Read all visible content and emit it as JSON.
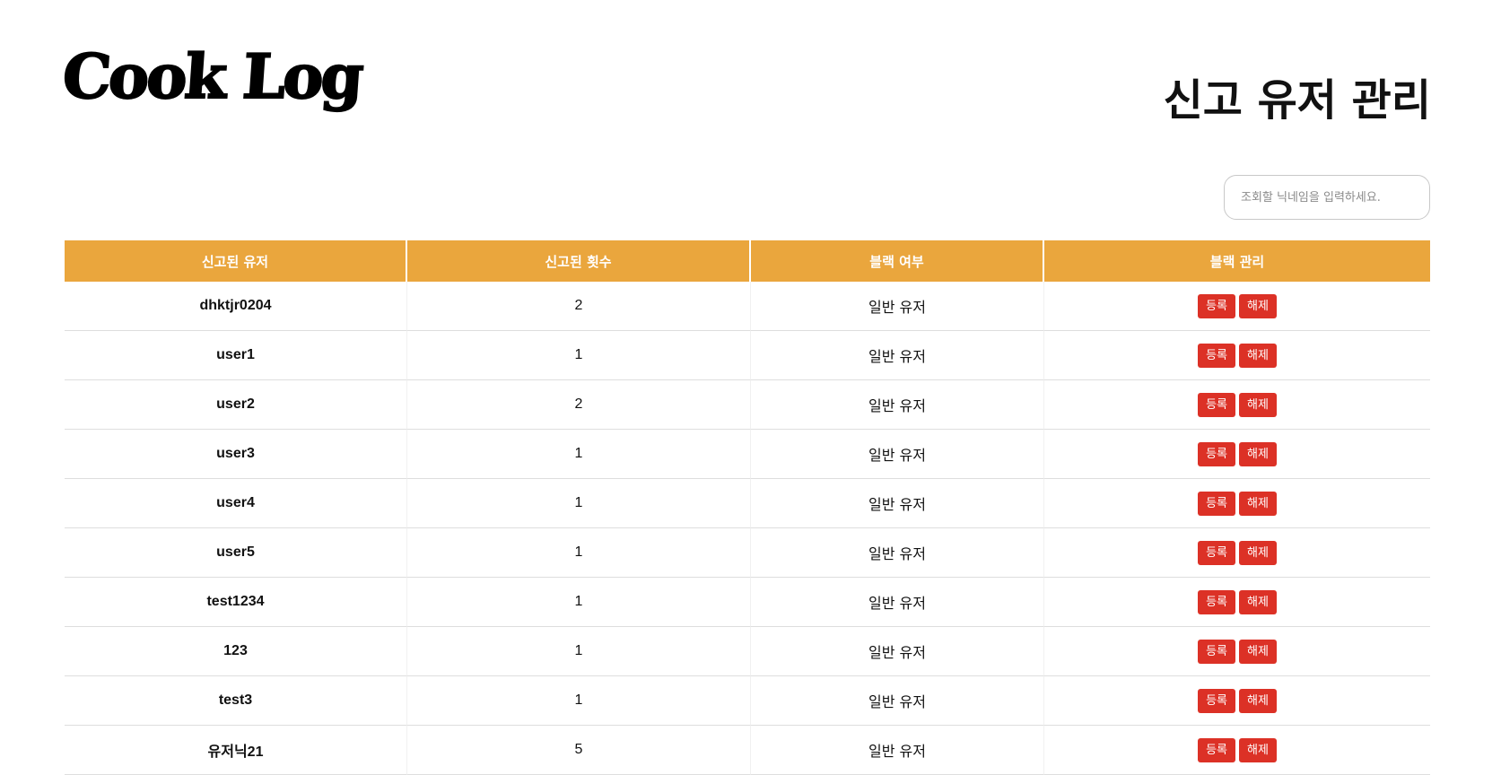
{
  "header": {
    "logo_text": "Cook Log",
    "page_title": "신고 유저 관리"
  },
  "search": {
    "placeholder": "조회할 닉네임을 입력하세요.",
    "value": ""
  },
  "table": {
    "columns": [
      "신고된 유저",
      "신고된 횟수",
      "블랙 여부",
      "블랙 관리"
    ],
    "register_label": "등록",
    "release_label": "해제",
    "rows": [
      {
        "user": "dhktjr0204",
        "count": "2",
        "status": "일반 유저"
      },
      {
        "user": "user1",
        "count": "1",
        "status": "일반 유저"
      },
      {
        "user": "user2",
        "count": "2",
        "status": "일반 유저"
      },
      {
        "user": "user3",
        "count": "1",
        "status": "일반 유저"
      },
      {
        "user": "user4",
        "count": "1",
        "status": "일반 유저"
      },
      {
        "user": "user5",
        "count": "1",
        "status": "일반 유저"
      },
      {
        "user": "test1234",
        "count": "1",
        "status": "일반 유저"
      },
      {
        "user": "123",
        "count": "1",
        "status": "일반 유저"
      },
      {
        "user": "test3",
        "count": "1",
        "status": "일반 유저"
      },
      {
        "user": "유저닉21",
        "count": "5",
        "status": "일반 유저"
      }
    ]
  },
  "colors": {
    "header_bg": "#eaa63d",
    "button_bg": "#dc3126"
  }
}
